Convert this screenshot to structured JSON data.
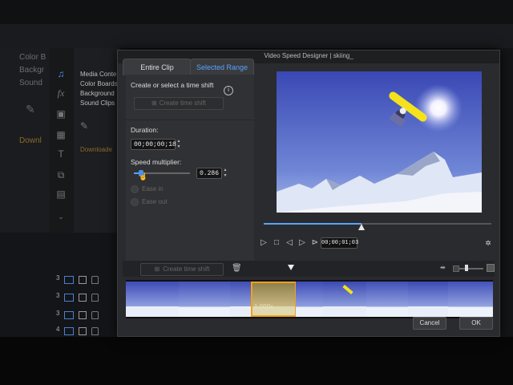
{
  "background_app": {
    "left_panel_items": [
      "Color B",
      "Backgr",
      "Sound",
      "Downl"
    ],
    "media_panel_items": [
      "Media Conte",
      "Color Boards",
      "Background",
      "Sound Clips",
      "Downloade"
    ],
    "track_numbers": [
      "3",
      "3",
      "3",
      "4"
    ]
  },
  "dialog": {
    "title": "Video Speed Designer  |  skiing_",
    "tabs": [
      {
        "label": "Entire Clip",
        "active": false
      },
      {
        "label": "Selected Range",
        "active": true
      }
    ],
    "panel": {
      "heading": "Create or select a time shift",
      "info_icon": "info-icon",
      "create_time_shift_label": "Create time shift",
      "duration_label": "Duration:",
      "duration_value": "00;00;00;18",
      "speed_label": "Speed multiplier:",
      "speed_value": "0.286",
      "speed_slider_fraction": 0.13,
      "ease_in_label": "Ease in",
      "ease_out_label": "Ease out"
    },
    "player": {
      "timecode": "00;00;01;03",
      "progress_fraction": 0.43,
      "controls": [
        "play-icon",
        "stop-icon",
        "prev-frame-icon",
        "next-frame-icon",
        "skip-icon"
      ]
    },
    "strip_toolbar": {
      "create_time_shift_label": "Create time shift",
      "trash_icon": "trash-icon",
      "zoom_fraction": 0.3
    },
    "selected_frame_label": "1.000x",
    "buttons": {
      "cancel": "Cancel",
      "ok": "OK"
    },
    "colors": {
      "accent": "#5aa2ff",
      "selection": "#f0a21a"
    }
  }
}
